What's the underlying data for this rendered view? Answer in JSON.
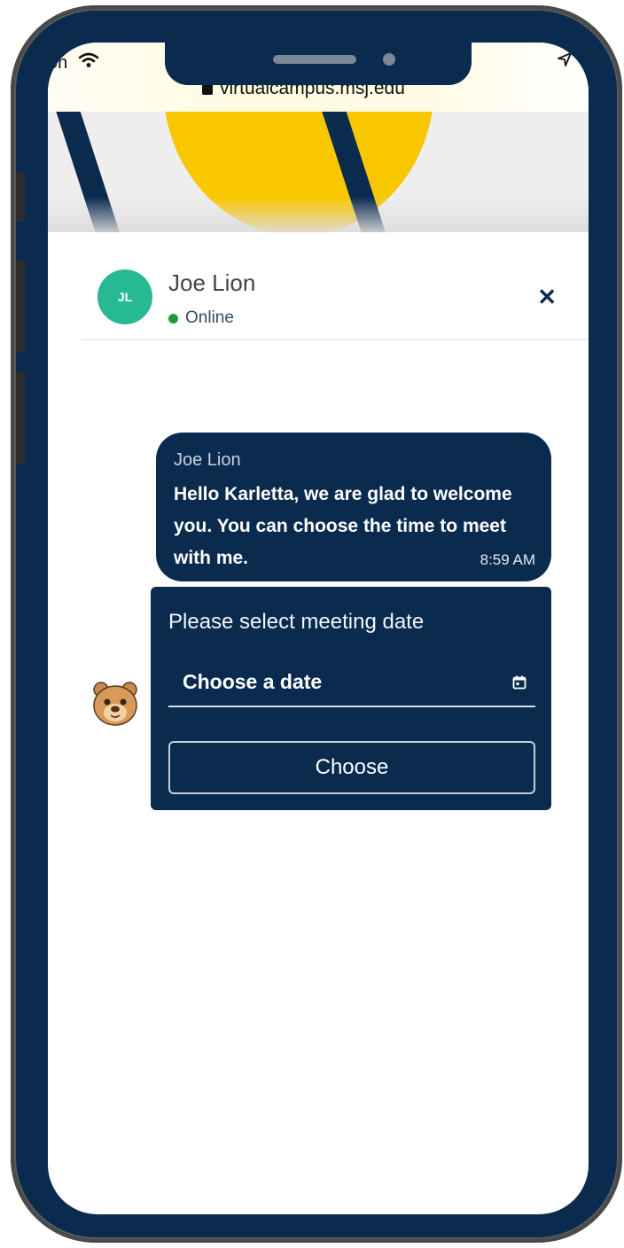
{
  "status_bar": {
    "carrier": "on",
    "url": "virtualcampus.msj.edu"
  },
  "chat": {
    "agent_initials": "JL",
    "agent_name": "Joe Lion",
    "status": "Online",
    "close_symbol": "✕"
  },
  "message": {
    "sender": "Joe Lion",
    "text": "Hello Karletta, we are glad to welcome you. You can choose the time to meet with me.",
    "time": "8:59 AM"
  },
  "date_card": {
    "prompt": "Please select meeting date",
    "date_value": "Choose a date",
    "button_label": "Choose"
  },
  "colors": {
    "navy": "#0a2a4e",
    "avatar_green": "#27b993",
    "online_green": "#1a9a3c",
    "hero_yellow": "#f8c700"
  },
  "icons": [
    "wifi-icon",
    "location-arrow-icon",
    "lock-icon",
    "close-icon",
    "calendar-icon",
    "lion-mascot-icon"
  ]
}
